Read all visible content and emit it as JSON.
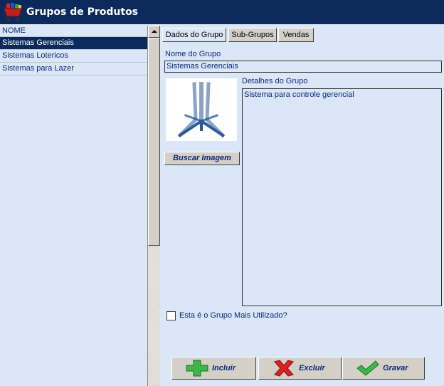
{
  "window": {
    "title": "Grupos de Produtos",
    "icon": "shopping-cart-icon"
  },
  "list": {
    "header": "NOME",
    "rows": [
      {
        "label": "Sistemas Gerenciais",
        "selected": true
      },
      {
        "label": "Sistemas Lotericos",
        "selected": false
      },
      {
        "label": "Sistemas para Lazer",
        "selected": false
      }
    ]
  },
  "tabs": [
    {
      "label": "Dados do Grupo",
      "active": true
    },
    {
      "label": "Sub-Grupos",
      "active": false
    },
    {
      "label": "Vendas",
      "active": false
    }
  ],
  "form": {
    "nome_label": "Nome do Grupo",
    "nome_value": "Sistemas Gerenciais",
    "detalhes_label": "Detalhes do Grupo",
    "detalhes_value": "Sistema para controle gerencial",
    "buscar_label": "Buscar Imagem",
    "checkbox_label": "Esta é o Grupo Mais Utilizado?",
    "checkbox_checked": false
  },
  "actions": {
    "incluir": {
      "label": "Incluir",
      "icon": "plus-icon"
    },
    "excluir": {
      "label": "Excluir",
      "icon": "x-icon"
    },
    "gravar": {
      "label": "Gravar",
      "icon": "check-icon"
    }
  },
  "colors": {
    "titlebar": "#0b2a5c",
    "background": "#dbe6f6",
    "selected_row": "#0b2a5c",
    "text": "#0a2a7a"
  }
}
